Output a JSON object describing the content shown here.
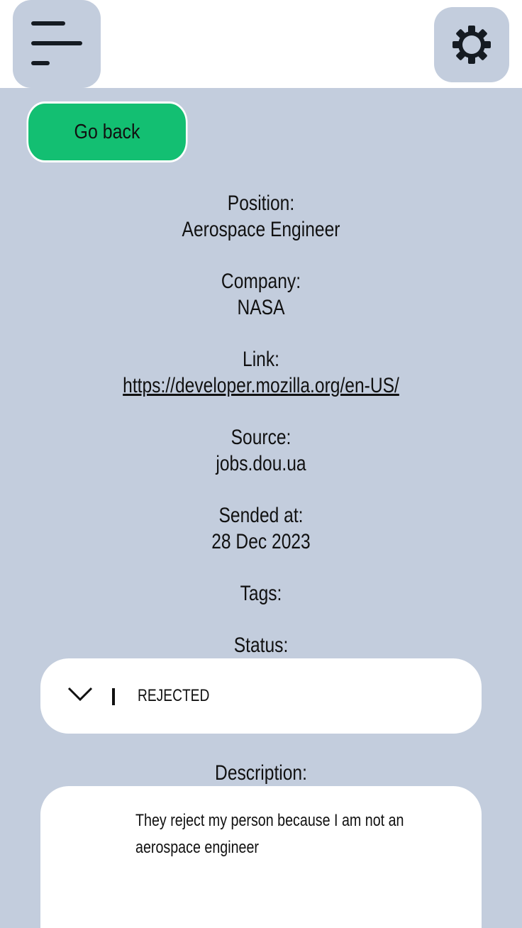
{
  "header": {
    "menu_icon": "menu-icon",
    "settings_icon": "gear-icon"
  },
  "go_back_label": "Go back",
  "fields": {
    "position_label": "Position:",
    "position_value": "Aerospace Engineer",
    "company_label": "Company:",
    "company_value": "NASA",
    "link_label": "Link:",
    "link_value": "https://developer.mozilla.org/en-US/",
    "source_label": "Source:",
    "source_value": "jobs.dou.ua",
    "sended_label": "Sended at:",
    "sended_value": "28 Dec 2023",
    "tags_label": "Tags:",
    "status_label": "Status:",
    "description_label": "Description:"
  },
  "status": {
    "selected": "REJECTED",
    "icon": "chevron-down-icon"
  },
  "description": {
    "text": "They reject my person because I am not an aerospace engineer"
  }
}
